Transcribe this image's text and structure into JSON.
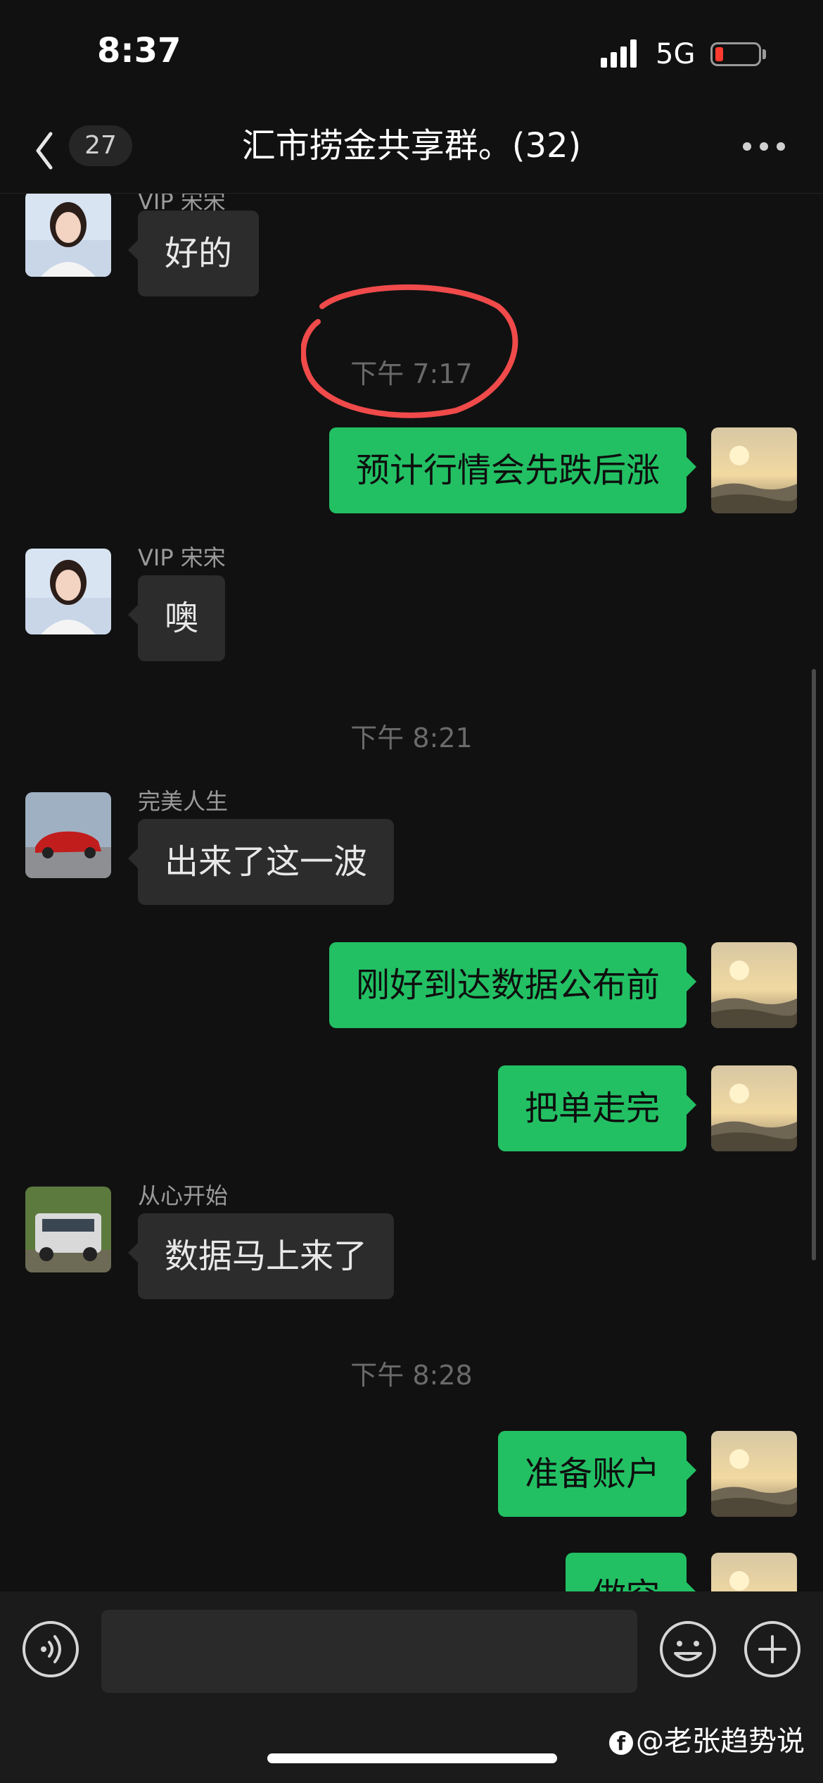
{
  "status_bar": {
    "time": "8:37",
    "network": "5G",
    "battery_color": "#ff3b30"
  },
  "header": {
    "unread_count": "27",
    "title": "汇市捞金共享群。(32)"
  },
  "chat": {
    "messages": [
      {
        "sender": "VIP 宋宋",
        "text": "好的"
      },
      {
        "time": "下午 7:17"
      },
      {
        "text": "预计行情会先跌后涨"
      },
      {
        "sender": "VIP 宋宋",
        "text": "噢"
      },
      {
        "time": "下午 8:21"
      },
      {
        "sender": "完美人生",
        "text": "出来了这一波"
      },
      {
        "text": "刚好到达数据公布前"
      },
      {
        "text": "把单走完"
      },
      {
        "sender": "从心开始",
        "text": "数据马上来了"
      },
      {
        "time": "下午 8:28"
      },
      {
        "text": "准备账户"
      },
      {
        "text": "做空"
      }
    ],
    "annotation_color": "#f04a4a"
  },
  "input_bar": {
    "placeholder": ""
  },
  "watermark": {
    "text": "@老张趋势说"
  },
  "colors": {
    "outgoing_bubble": "#22c063",
    "incoming_bubble": "#2c2c2c",
    "background": "#111111"
  }
}
